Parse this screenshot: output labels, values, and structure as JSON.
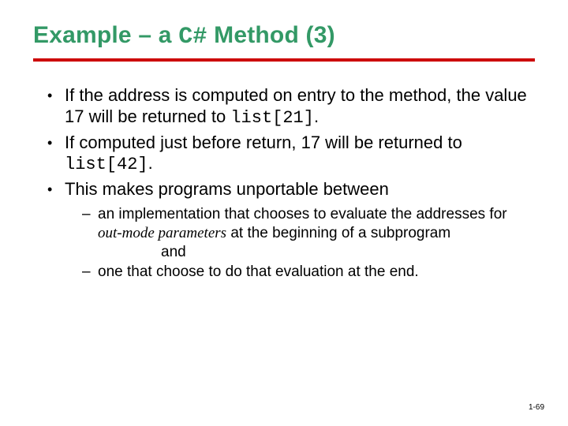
{
  "title_pre": "Example – a ",
  "title_code": "C#",
  "title_post": " Method (3)",
  "bullets": {
    "b1_pre": "If the address is computed on entry to the method, the value 17 will be returned to ",
    "b1_code": "list[21]",
    "b1_post": ".",
    "b2_pre": "If computed just before return, 17 will be returned to ",
    "b2_code": "list[42]",
    "b2_post": ".",
    "b3": "This makes programs unportable between"
  },
  "sub": {
    "s1_pre": "an implementation that chooses to evaluate the addresses for ",
    "s1_em": "out-mode parameters",
    "s1_post": " at the beginning of a subprogram",
    "s1_and": "and",
    "s2": "one that choose to do that evaluation at the end."
  },
  "page_number": "1-69"
}
